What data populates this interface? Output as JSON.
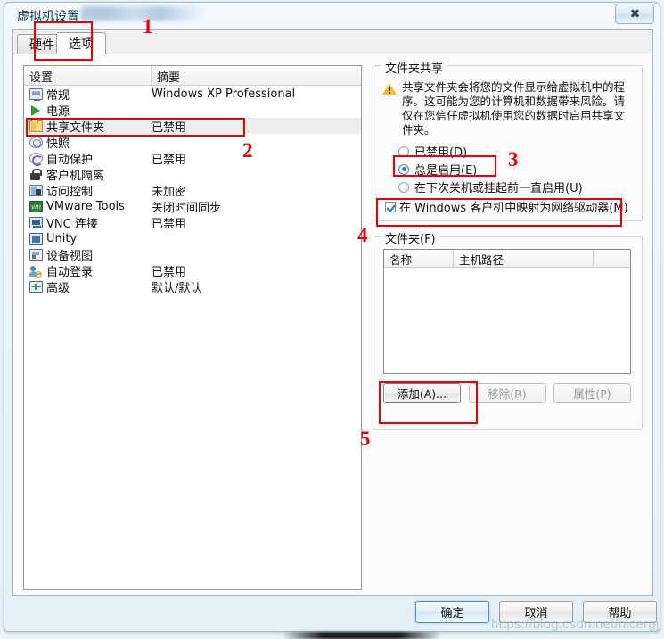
{
  "window": {
    "title": "虚拟机设置",
    "close_label": "✕"
  },
  "tabs": [
    {
      "label": "硬件",
      "active": false
    },
    {
      "label": "选项",
      "active": true
    }
  ],
  "settings_list": {
    "columns": [
      "设置",
      "摘要"
    ],
    "rows": [
      {
        "icon": "monitor-icon",
        "label": "常规",
        "summary": "Windows XP Professional",
        "selected": false
      },
      {
        "icon": "power-play-icon",
        "label": "电源",
        "summary": "",
        "selected": false
      },
      {
        "icon": "shared-folder-icon",
        "label": "共享文件夹",
        "summary": "已禁用",
        "selected": true
      },
      {
        "icon": "snapshot-icon",
        "label": "快照",
        "summary": "",
        "selected": false
      },
      {
        "icon": "autoprotect-icon",
        "label": "自动保护",
        "summary": "已禁用",
        "selected": false
      },
      {
        "icon": "lock-icon",
        "label": "客户机隔离",
        "summary": "",
        "selected": false
      },
      {
        "icon": "access-control-icon",
        "label": "访问控制",
        "summary": "未加密",
        "selected": false
      },
      {
        "icon": "vmware-tools-icon",
        "label": "VMware Tools",
        "summary": "关闭时间同步",
        "selected": false
      },
      {
        "icon": "vnc-icon",
        "label": "VNC 连接",
        "summary": "已禁用",
        "selected": false
      },
      {
        "icon": "unity-icon",
        "label": "Unity",
        "summary": "",
        "selected": false
      },
      {
        "icon": "device-view-icon",
        "label": "设备视图",
        "summary": "",
        "selected": false
      },
      {
        "icon": "auto-login-icon",
        "label": "自动登录",
        "summary": "已禁用",
        "selected": false
      },
      {
        "icon": "advanced-icon",
        "label": "高级",
        "summary": "默认/默认",
        "selected": false
      }
    ]
  },
  "sharing_group": {
    "title": "文件夹共享",
    "warning_text": "共享文件夹会将您的文件显示给虚拟机中的程序。这可能为您的计算机和数据带来风险。请仅在您信任虚拟机使用您的数据时启用共享文件夹。",
    "radios": [
      {
        "label": "已禁用(D)",
        "accel": "D",
        "selected": false
      },
      {
        "label": "总是启用(E)",
        "accel": "E",
        "selected": true
      },
      {
        "label": "在下次关机或挂起前一直启用(U)",
        "accel": "U",
        "selected": false
      }
    ],
    "checkbox": {
      "label": "在 Windows 客户机中映射为网络驱动器(M)",
      "accel": "M",
      "checked": true
    }
  },
  "folders_group": {
    "title": "文件夹(F)",
    "columns": [
      "名称",
      "主机路径",
      ""
    ],
    "rows": [],
    "buttons": [
      {
        "label": "添加(A)...",
        "disabled": false,
        "focused": true
      },
      {
        "label": "移除(R)",
        "disabled": true,
        "focused": false
      },
      {
        "label": "属性(P)",
        "disabled": true,
        "focused": false
      }
    ]
  },
  "footer": {
    "ok": "确定",
    "cancel": "取消",
    "help": "帮助"
  },
  "annotations": [
    {
      "number": "1"
    },
    {
      "number": "2"
    },
    {
      "number": "3"
    },
    {
      "number": "4"
    },
    {
      "number": "5"
    }
  ],
  "watermark": "https://blog.csdn.net/nicergj",
  "colors": {
    "annotation_red": "#f20000",
    "accent_blue": "#2a7fd4",
    "warning_yellow": "#f5c01f"
  }
}
